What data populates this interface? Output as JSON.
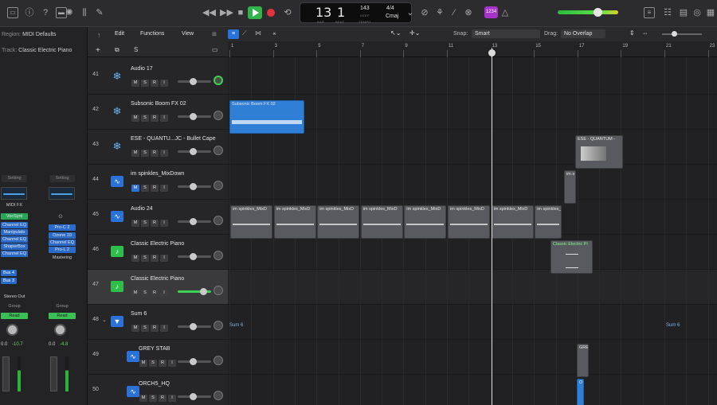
{
  "toolbar": {
    "lcd": {
      "bar": "13",
      "beat": "1",
      "bar_cap": "BAR",
      "beat_cap": "BEAT",
      "tempo": "143",
      "tempo_cap": "KEEP",
      "tempo_cap2": "TEMPO",
      "signature": "4/4",
      "key": "Cmaj"
    },
    "badge": "1234"
  },
  "inspector": {
    "region_label": "Region:",
    "region_value": "MIDI Defaults",
    "track_label": "Track:",
    "track_value": "Classic Electric Piano",
    "left_strip": {
      "setting": "Setting",
      "midi_fx": "MIDI FX",
      "instrument": "VocSynt",
      "plugins": [
        "Channel EQ",
        "Manipulato",
        "Channel EQ",
        "ShaperBox",
        "Channel EQ"
      ],
      "sends": [
        "Bus 4",
        "Bus 3"
      ],
      "output": "Stereo Out",
      "group": "Group",
      "automation": "Read",
      "pan_value": "0.0",
      "gain_value": "-10.7"
    },
    "right_strip": {
      "setting": "Setting",
      "plugins": [
        "Pro-C 2",
        "Ozone 10",
        "Channel EQ",
        "Pro-L 2"
      ],
      "output": "Mastering",
      "group": "Group",
      "automation": "Read",
      "pan_value": "0.0",
      "gain_value": "-4.8"
    }
  },
  "tracklist": {
    "tracks": [
      {
        "num": "41",
        "name": "Audio 17",
        "icon": "snowflake-icon"
      },
      {
        "num": "42",
        "name": "Subsonic Boom FX 02",
        "icon": "snowflake-icon"
      },
      {
        "num": "43",
        "name": "ESE - QUANTU...JC - Bullet Cape",
        "icon": "snowflake-icon"
      },
      {
        "num": "44",
        "name": "im spinkles_MixDown",
        "icon": "waveform-icon"
      },
      {
        "num": "45",
        "name": "Audio 24",
        "icon": "waveform-icon"
      },
      {
        "num": "46",
        "name": "Classic Electric Piano",
        "icon": "piano-icon"
      },
      {
        "num": "47",
        "name": "Classic Electric Piano",
        "icon": "piano-icon"
      },
      {
        "num": "48",
        "name": "Sum 6",
        "icon": "stack-icon"
      },
      {
        "num": "49",
        "name": "GREY STAB",
        "icon": "waveform-icon"
      },
      {
        "num": "50",
        "name": "ORCH5_HQ",
        "icon": "waveform-icon"
      }
    ],
    "buttons": {
      "m": "M",
      "s": "S",
      "r": "R",
      "i": "I"
    }
  },
  "arrange": {
    "menus": {
      "edit": "Edit",
      "functions": "Functions",
      "view": "View"
    },
    "snap_label": "Snap:",
    "snap_value": "Smart",
    "drag_label": "Drag:",
    "drag_value": "No Overlap",
    "ruler": [
      "1",
      "3",
      "5",
      "7",
      "9",
      "11",
      "13",
      "15",
      "17",
      "19",
      "21",
      "23"
    ],
    "regions": {
      "subsonic": "Subsonic Boom FX 02",
      "ese": "ESE - QUANTUM -",
      "ims_short": "im s",
      "ims": "im spinkles_MixD",
      "classic": "Classic Electric Pi",
      "sum_left": "Sum 6",
      "sum_right": "Sum 6",
      "grey": "GRE",
      "orch": "O"
    }
  }
}
